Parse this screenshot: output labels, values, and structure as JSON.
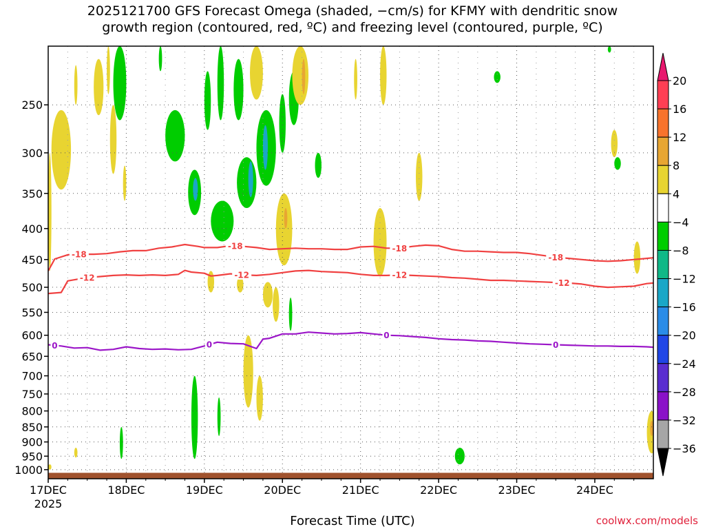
{
  "title": {
    "line1": "2025121700 GFS Forecast Omega (shaded, −cm/s) for KFMY with dendritic snow",
    "line2": "growth region (contoured, red, ºC) and freezing level (contoured, purple, ºC)"
  },
  "credit": "coolwx.com/models",
  "chart_data": {
    "type": "heatmap",
    "title": "2025121700 GFS Forecast Omega (shaded, −cm/s) for KFMY with dendritic snow growth region (contoured, red, ºC) and freezing level (contoured, purple, ºC)",
    "xlabel": "Forecast Time (UTC)",
    "ylabel": "",
    "x_ticks": [
      {
        "label": "17DEC",
        "sublabel": "2025",
        "hours": 0
      },
      {
        "label": "18DEC",
        "hours": 24
      },
      {
        "label": "19DEC",
        "hours": 48
      },
      {
        "label": "20DEC",
        "hours": 72
      },
      {
        "label": "21DEC",
        "hours": 96
      },
      {
        "label": "22DEC",
        "hours": 120
      },
      {
        "label": "23DEC",
        "hours": 144
      },
      {
        "label": "24DEC",
        "hours": 168
      }
    ],
    "xlim_hours": [
      0,
      186
    ],
    "y_ticks": [
      250,
      300,
      350,
      400,
      450,
      500,
      550,
      600,
      650,
      700,
      750,
      800,
      850,
      900,
      950,
      1000
    ],
    "ylim_hpa": [
      200,
      1035
    ],
    "y_scale": "log",
    "grid": true,
    "colorbar": {
      "labels": [
        "20",
        "16",
        "12",
        "8",
        "4",
        "−4",
        "−8",
        "−12",
        "−16",
        "−20",
        "−24",
        "−28",
        "−32",
        "−36"
      ],
      "colors": [
        "#ff3f54",
        "#f8732c",
        "#e8a632",
        "#e8d431",
        "#ffffff",
        "#00cd00",
        "#10b887",
        "#1aa7c7",
        "#2a8ce8",
        "#2046e6",
        "#5a2dd0",
        "#8a12c8",
        "#a6a6a6"
      ],
      "top_arrow": "#e8186e",
      "bottom_arrow": "#000000"
    },
    "shading": [
      {
        "color": "#e8d431",
        "hours": [
          0,
          1
        ],
        "hpa": [
          300,
          470
        ]
      },
      {
        "color": "#e8d431",
        "hours": [
          1,
          7
        ],
        "hpa": [
          255,
          345
        ]
      },
      {
        "color": "#e8d431",
        "hours": [
          8,
          9
        ],
        "hpa": [
          215,
          250
        ]
      },
      {
        "color": "#e8d431",
        "hours": [
          14,
          17
        ],
        "hpa": [
          210,
          260
        ]
      },
      {
        "color": "#e8d431",
        "hours": [
          19,
          21
        ],
        "hpa": [
          250,
          325
        ]
      },
      {
        "color": "#e8d431",
        "hours": [
          23,
          24
        ],
        "hpa": [
          315,
          360
        ]
      },
      {
        "color": "#e8d431",
        "hours": [
          18,
          19
        ],
        "hpa": [
          200,
          240
        ]
      },
      {
        "color": "#1aa7c7",
        "hours": [
          21.5,
          23
        ],
        "hpa": [
          205,
          250
        ]
      },
      {
        "color": "#00cd00",
        "hours": [
          20,
          24
        ],
        "hpa": [
          200,
          265
        ]
      },
      {
        "color": "#00cd00",
        "hours": [
          34,
          35
        ],
        "hpa": [
          200,
          220
        ]
      },
      {
        "color": "#00cd00",
        "hours": [
          36,
          42
        ],
        "hpa": [
          255,
          310
        ]
      },
      {
        "color": "#00cd00",
        "hours": [
          43,
          47
        ],
        "hpa": [
          320,
          380
        ]
      },
      {
        "color": "#1aa7c7",
        "hours": [
          44.5,
          46
        ],
        "hpa": [
          330,
          360
        ]
      },
      {
        "color": "#00cd00",
        "hours": [
          48,
          50
        ],
        "hpa": [
          220,
          275
        ]
      },
      {
        "color": "#00cd00",
        "hours": [
          50,
          57
        ],
        "hpa": [
          360,
          420
        ]
      },
      {
        "color": "#00cd00",
        "hours": [
          52,
          54
        ],
        "hpa": [
          200,
          265
        ]
      },
      {
        "color": "#00cd00",
        "hours": [
          57,
          60
        ],
        "hpa": [
          210,
          265
        ]
      },
      {
        "color": "#00cd00",
        "hours": [
          58,
          64
        ],
        "hpa": [
          305,
          370
        ]
      },
      {
        "color": "#1aa7c7",
        "hours": [
          61.5,
          63
        ],
        "hpa": [
          310,
          355
        ]
      },
      {
        "color": "#00cd00",
        "hours": [
          64,
          70
        ],
        "hpa": [
          255,
          340
        ]
      },
      {
        "color": "#1aa7c7",
        "hours": [
          66,
          67.5
        ],
        "hpa": [
          270,
          320
        ]
      },
      {
        "color": "#e8d431",
        "hours": [
          62,
          66
        ],
        "hpa": [
          200,
          245
        ]
      },
      {
        "color": "#00cd00",
        "hours": [
          71,
          73
        ],
        "hpa": [
          240,
          300
        ]
      },
      {
        "color": "#00cd00",
        "hours": [
          74,
          77
        ],
        "hpa": [
          220,
          270
        ]
      },
      {
        "color": "#e8d431",
        "hours": [
          75,
          80
        ],
        "hpa": [
          200,
          250
        ]
      },
      {
        "color": "#e8a632",
        "hours": [
          78,
          79
        ],
        "hpa": [
          210,
          240
        ]
      },
      {
        "color": "#00cd00",
        "hours": [
          82,
          84
        ],
        "hpa": [
          300,
          330
        ]
      },
      {
        "color": "#e8d431",
        "hours": [
          70,
          75
        ],
        "hpa": [
          350,
          460
        ]
      },
      {
        "color": "#e8a632",
        "hours": [
          72.5,
          73.5
        ],
        "hpa": [
          370,
          400
        ]
      },
      {
        "color": "#e8d431",
        "hours": [
          49,
          51
        ],
        "hpa": [
          470,
          510
        ]
      },
      {
        "color": "#e8d431",
        "hours": [
          58,
          60
        ],
        "hpa": [
          480,
          510
        ]
      },
      {
        "color": "#e8d431",
        "hours": [
          66,
          69
        ],
        "hpa": [
          490,
          540
        ]
      },
      {
        "color": "#e8d431",
        "hours": [
          60,
          63
        ],
        "hpa": [
          600,
          790
        ]
      },
      {
        "color": "#e8d431",
        "hours": [
          64,
          66
        ],
        "hpa": [
          700,
          830
        ]
      },
      {
        "color": "#e8d431",
        "hours": [
          69,
          71
        ],
        "hpa": [
          500,
          570
        ]
      },
      {
        "color": "#00cd00",
        "hours": [
          74,
          75
        ],
        "hpa": [
          520,
          590
        ]
      },
      {
        "color": "#00cd00",
        "hours": [
          44,
          46
        ],
        "hpa": [
          700,
          960
        ]
      },
      {
        "color": "#00cd00",
        "hours": [
          52,
          53
        ],
        "hpa": [
          760,
          880
        ]
      },
      {
        "color": "#00cd00",
        "hours": [
          22,
          23
        ],
        "hpa": [
          850,
          960
        ]
      },
      {
        "color": "#00cd00",
        "hours": [
          101,
          102
        ],
        "hpa": [
          400,
          470
        ]
      },
      {
        "color": "#e8d431",
        "hours": [
          100,
          104
        ],
        "hpa": [
          370,
          480
        ]
      },
      {
        "color": "#e8d431",
        "hours": [
          113,
          115
        ],
        "hpa": [
          300,
          360
        ]
      },
      {
        "color": "#e8d431",
        "hours": [
          102,
          104
        ],
        "hpa": [
          200,
          250
        ]
      },
      {
        "color": "#e8d431",
        "hours": [
          94,
          95
        ],
        "hpa": [
          210,
          245
        ]
      },
      {
        "color": "#00cd00",
        "hours": [
          137,
          139
        ],
        "hpa": [
          220,
          230
        ]
      },
      {
        "color": "#00cd00",
        "hours": [
          172,
          173
        ],
        "hpa": [
          200,
          205
        ]
      },
      {
        "color": "#e8d431",
        "hours": [
          173,
          175
        ],
        "hpa": [
          275,
          305
        ]
      },
      {
        "color": "#00cd00",
        "hours": [
          174,
          176
        ],
        "hpa": [
          305,
          320
        ]
      },
      {
        "color": "#e8d431",
        "hours": [
          180,
          182
        ],
        "hpa": [
          420,
          475
        ]
      },
      {
        "color": "#e8d431",
        "hours": [
          184,
          187
        ],
        "hpa": [
          800,
          940
        ]
      },
      {
        "color": "#e8a632",
        "hours": [
          185,
          186
        ],
        "hpa": [
          830,
          880
        ]
      },
      {
        "color": "#00cd00",
        "hours": [
          125,
          128
        ],
        "hpa": [
          920,
          980
        ]
      },
      {
        "color": "#e8d431",
        "hours": [
          0,
          1
        ],
        "hpa": [
          980,
          1000
        ]
      },
      {
        "color": "#e8d431",
        "hours": [
          8,
          9
        ],
        "hpa": [
          920,
          955
        ]
      }
    ],
    "contours": [
      {
        "name": "-18",
        "color": "#f04040",
        "hours": [
          0,
          2,
          6,
          10,
          14,
          18,
          22,
          26,
          30,
          34,
          38,
          42,
          46,
          48,
          52,
          56,
          60,
          64,
          68,
          72,
          76,
          80,
          84,
          88,
          92,
          96,
          100,
          104,
          108,
          112,
          116,
          120,
          124,
          128,
          132,
          136,
          140,
          144,
          148,
          152,
          156,
          160,
          164,
          168,
          172,
          176,
          180,
          184,
          186
        ],
        "hpa": [
          470,
          449,
          442,
          441,
          441,
          440,
          437,
          435,
          435,
          431,
          429,
          425,
          428,
          430,
          430,
          427,
          428,
          430,
          433,
          432,
          431,
          432,
          432,
          433,
          433,
          429,
          428,
          431,
          431,
          428,
          426,
          427,
          433,
          436,
          436,
          437,
          438,
          438,
          440,
          443,
          446,
          448,
          450,
          452,
          453,
          452,
          450,
          448,
          447
        ],
        "labels": [
          {
            "text": "-18",
            "hours": 9.5
          },
          {
            "text": "-18",
            "hours": 57.5
          },
          {
            "text": "-18",
            "hours": 108
          },
          {
            "text": "-18",
            "hours": 156
          }
        ]
      },
      {
        "name": "-12",
        "color": "#f04040",
        "hours": [
          0,
          4,
          6,
          8,
          12,
          16,
          20,
          24,
          28,
          32,
          36,
          40,
          42,
          44,
          48,
          50,
          52,
          56,
          60,
          64,
          68,
          72,
          76,
          80,
          84,
          88,
          92,
          96,
          100,
          104,
          108,
          112,
          116,
          120,
          124,
          128,
          132,
          136,
          140,
          144,
          148,
          152,
          156,
          160,
          164,
          168,
          172,
          176,
          180,
          184,
          186
        ],
        "hpa": [
          512,
          510,
          488,
          486,
          482,
          480,
          478,
          477,
          478,
          477,
          478,
          476,
          469,
          472,
          474,
          479,
          478,
          475,
          477,
          478,
          476,
          473,
          470,
          469,
          471,
          472,
          473,
          476,
          478,
          478,
          477,
          478,
          479,
          480,
          482,
          483,
          485,
          487,
          487,
          488,
          489,
          490,
          491,
          492,
          494,
          498,
          500,
          499,
          498,
          493,
          492
        ],
        "labels": [
          {
            "text": "-12",
            "hours": 12
          },
          {
            "text": "-12",
            "hours": 59.5
          },
          {
            "text": "-12",
            "hours": 108
          },
          {
            "text": "-12",
            "hours": 158
          }
        ]
      },
      {
        "name": "0",
        "color": "#9b16c8",
        "hours": [
          0,
          4,
          8,
          12,
          16,
          20,
          24,
          28,
          32,
          36,
          40,
          44,
          48,
          52,
          56,
          60,
          64,
          66,
          68,
          72,
          76,
          80,
          84,
          88,
          92,
          96,
          100,
          104,
          108,
          112,
          116,
          120,
          124,
          128,
          132,
          136,
          140,
          144,
          148,
          152,
          156,
          160,
          164,
          168,
          172,
          176,
          180,
          184,
          186
        ],
        "hpa": [
          622,
          625,
          630,
          629,
          635,
          633,
          627,
          631,
          633,
          632,
          634,
          633,
          625,
          616,
          619,
          620,
          631,
          609,
          607,
          597,
          597,
          593,
          595,
          597,
          596,
          594,
          597,
          600,
          601,
          603,
          605,
          608,
          610,
          611,
          613,
          614,
          616,
          618,
          620,
          621,
          622,
          623,
          624,
          625,
          625,
          626,
          626,
          627,
          628
        ],
        "labels": [
          {
            "text": "0",
            "hours": 2
          },
          {
            "text": "0",
            "hours": 49.5
          },
          {
            "text": "0",
            "hours": 104
          },
          {
            "text": "0",
            "hours": 156
          }
        ]
      }
    ],
    "terrain": {
      "color": "#a0522d",
      "from_hpa": 1012
    }
  }
}
